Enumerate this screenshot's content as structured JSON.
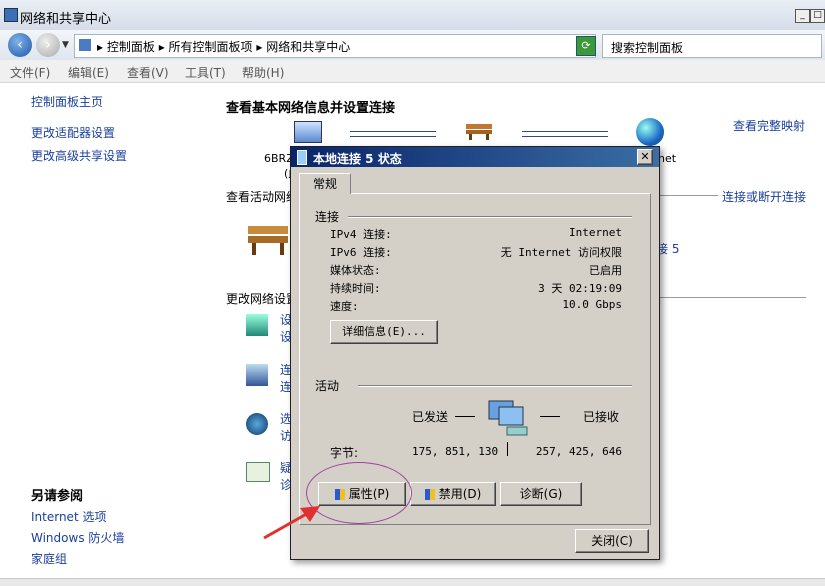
{
  "window": {
    "title": "网络和共享中心"
  },
  "breadcrumb": {
    "items": [
      "控制面板",
      "所有控制面板项",
      "网络和共享中心"
    ]
  },
  "search": {
    "placeholder": "搜索控制面板"
  },
  "menu": [
    "文件(F)",
    "编辑(E)",
    "查看(V)",
    "工具(T)",
    "帮助(H)"
  ],
  "sidebar": {
    "links": [
      "控制面板主页",
      "更改适配器设置",
      "更改高级共享设置"
    ],
    "see_also_title": "另请参阅",
    "see_also": [
      "Internet 选项",
      "Windows 防火墙",
      "家庭组"
    ]
  },
  "main": {
    "heading": "查看基本网络信息并设置连接",
    "view_full_map": "查看完整映射",
    "computer_name": "6BRZ",
    "computer_name_tail": "(此",
    "internet_label": "net",
    "active_networks": "查看活动网络",
    "connect_disconnect": "连接或断开连接",
    "conn_partial_1": "t",
    "conn_partial_2": "接 5",
    "change_settings": "更改网络设置",
    "tasks": [
      {
        "l1": "设",
        "l2": "设"
      },
      {
        "l1": "连",
        "l2": "连"
      },
      {
        "l1": "选",
        "l2": "访"
      },
      {
        "l1": "疑",
        "l2": "诊"
      }
    ]
  },
  "dialog": {
    "title": "本地连接 5 状态",
    "tab": "常规",
    "connection_section": "连接",
    "rows": [
      {
        "label": "IPv4 连接:",
        "value": "Internet"
      },
      {
        "label": "IPv6 连接:",
        "value": "无 Internet 访问权限"
      },
      {
        "label": "媒体状态:",
        "value": "已启用"
      },
      {
        "label": "持续时间:",
        "value": "3 天 02:19:09"
      },
      {
        "label": "速度:",
        "value": "10.0 Gbps"
      }
    ],
    "details_button": "详细信息(E)...",
    "activity_section": "活动",
    "sent_label": "已发送",
    "received_label": "已接收",
    "bytes_label": "字节:",
    "bytes_sent": "175, 851, 130",
    "bytes_received": "257, 425, 646",
    "properties_button": "属性(P)",
    "disable_button": "禁用(D)",
    "diagnose_button": "诊断(G)",
    "close_button": "关闭(C)"
  },
  "colors": {
    "link": "#1a3f9c",
    "dialog_bg": "#d4d0c8",
    "titlebar_active": "#0a246a",
    "annotation": "#a040a0",
    "arrow": "#e03030"
  }
}
